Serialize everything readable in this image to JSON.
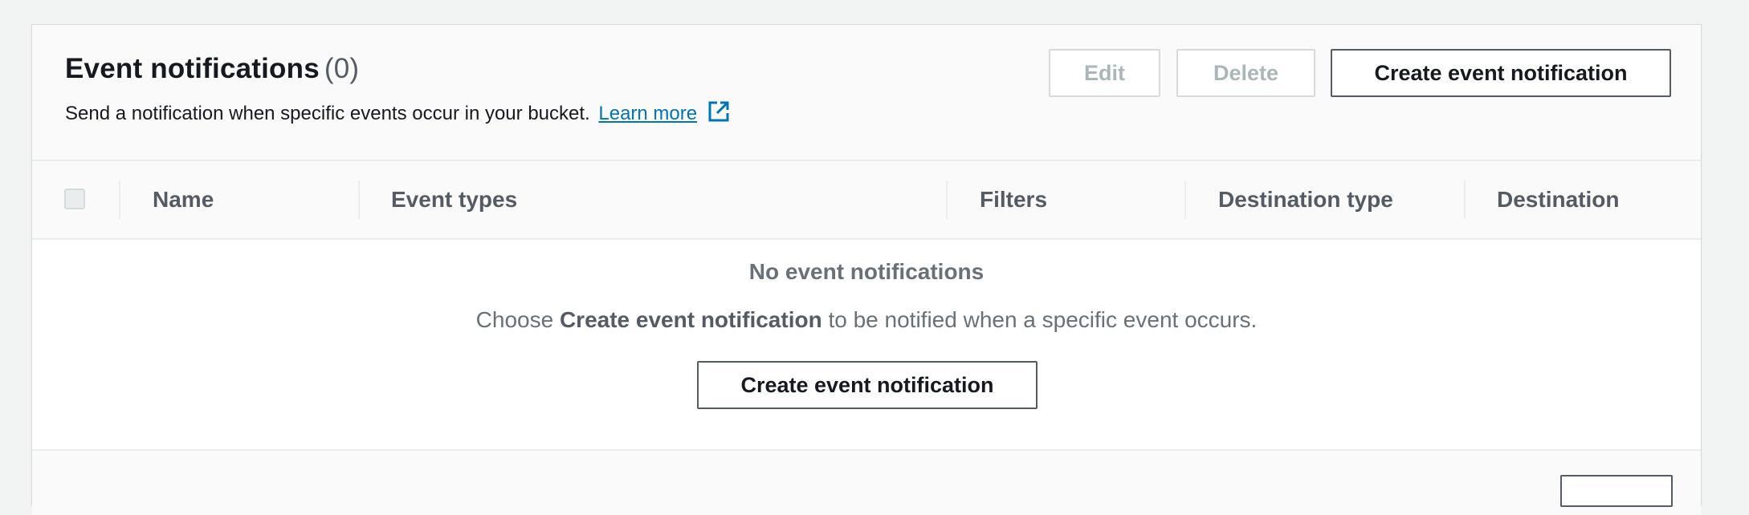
{
  "header": {
    "title": "Event notifications",
    "count": "(0)",
    "description": "Send a notification when specific events occur in your bucket.",
    "learn_more": "Learn more",
    "link_icon": "external-link-icon"
  },
  "actions": {
    "edit": "Edit",
    "delete": "Delete",
    "create": "Create event notification"
  },
  "table": {
    "columns": [
      "Name",
      "Event types",
      "Filters",
      "Destination type",
      "Destination"
    ],
    "rows": []
  },
  "empty_state": {
    "title": "No event notifications",
    "desc_prefix": "Choose",
    "desc_bold": "Create event notification",
    "desc_suffix": "to be notified when a specific event occurs.",
    "button": "Create event notification"
  },
  "colors": {
    "link": "#0073bb",
    "text": "#16191f",
    "muted": "#687078",
    "disabled": "#aab7b8"
  }
}
